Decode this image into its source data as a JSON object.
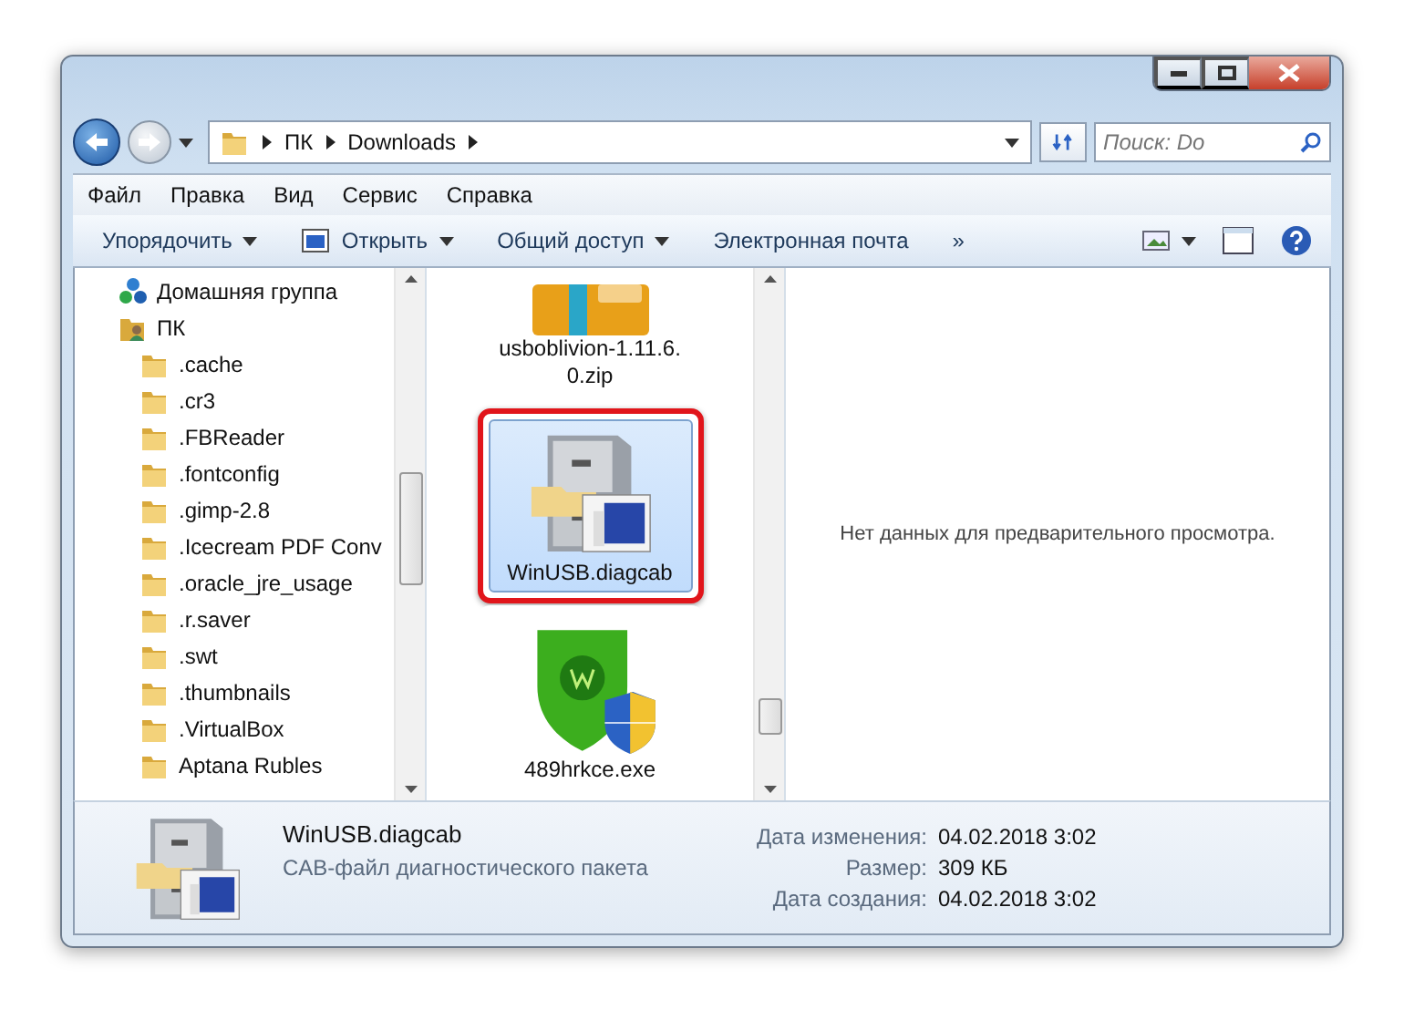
{
  "address": {
    "segments": [
      "ПК",
      "Downloads"
    ]
  },
  "search": {
    "placeholder": "Поиск: Do"
  },
  "menu": [
    "Файл",
    "Правка",
    "Вид",
    "Сервис",
    "Справка"
  ],
  "toolbar": [
    {
      "label": "Упорядочить",
      "icon": false,
      "dropdown": true
    },
    {
      "label": "Открыть",
      "icon": true,
      "dropdown": true
    },
    {
      "label": "Общий доступ",
      "icon": false,
      "dropdown": true
    },
    {
      "label": "Электронная почта",
      "icon": false,
      "dropdown": false
    },
    {
      "label": "»",
      "icon": false,
      "dropdown": false
    }
  ],
  "nav": [
    {
      "label": "Домашняя группа",
      "kind": "homegroup"
    },
    {
      "label": "ПК",
      "kind": "computer",
      "children": [
        {
          "label": ".cache",
          "kind": "folder"
        },
        {
          "label": ".cr3",
          "kind": "folder"
        },
        {
          "label": ".FBReader",
          "kind": "folder"
        },
        {
          "label": ".fontconfig",
          "kind": "folder"
        },
        {
          "label": ".gimp-2.8",
          "kind": "folder"
        },
        {
          "label": ".Icecream PDF Conv",
          "kind": "folder"
        },
        {
          "label": ".oracle_jre_usage",
          "kind": "folder"
        },
        {
          "label": ".r.saver",
          "kind": "folder"
        },
        {
          "label": ".swt",
          "kind": "folder"
        },
        {
          "label": ".thumbnails",
          "kind": "folder"
        },
        {
          "label": ".VirtualBox",
          "kind": "folder"
        },
        {
          "label": "Aptana Rubles",
          "kind": "folder"
        }
      ]
    }
  ],
  "files": [
    {
      "name": "usboblivion-1.11.6.0.zip",
      "kind": "archive",
      "selected": false,
      "highlighted": false
    },
    {
      "name": "WinUSB.diagcab",
      "kind": "cabinet",
      "selected": true,
      "highlighted": true
    },
    {
      "name": "489hrkce.exe",
      "kind": "shield",
      "selected": false,
      "highlighted": false
    }
  ],
  "preview": {
    "message": "Нет данных для предварительного просмотра."
  },
  "details": {
    "name": "WinUSB.diagcab",
    "type": "CAB-файл диагностического пакета",
    "fields": [
      {
        "label": "Дата изменения:",
        "value": "04.02.2018 3:02"
      },
      {
        "label": "Размер:",
        "value": "309 КБ"
      },
      {
        "label": "Дата создания:",
        "value": "04.02.2018 3:02"
      }
    ]
  }
}
